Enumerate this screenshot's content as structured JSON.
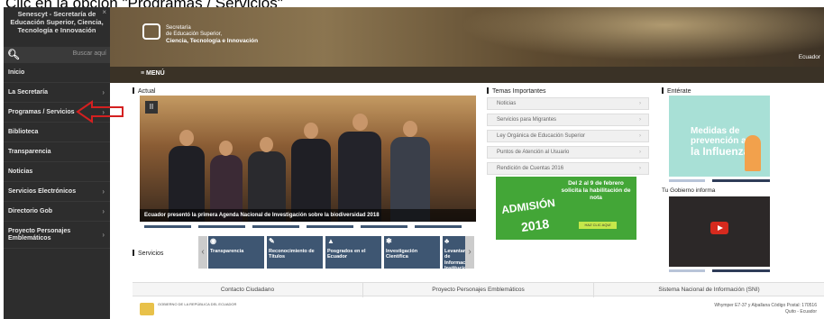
{
  "caption": "Clic en la opción \"Programas / Servicios\"",
  "sidebar": {
    "title": "Senescyt - Secretaría de Educación Superior, Ciencia, Tecnología e Innovación",
    "close_icon": "×",
    "search_placeholder": "Buscar aquí",
    "items": [
      {
        "label": "Inicio",
        "has_chevron": false
      },
      {
        "label": "La Secretaría",
        "has_chevron": true
      },
      {
        "label": "Programas / Servicios",
        "has_chevron": true
      },
      {
        "label": "Biblioteca",
        "has_chevron": false
      },
      {
        "label": "Transparencia",
        "has_chevron": false
      },
      {
        "label": "Noticias",
        "has_chevron": false
      },
      {
        "label": "Servicios Electrónicos",
        "has_chevron": true
      },
      {
        "label": "Directorio Gob",
        "has_chevron": true
      },
      {
        "label": "Proyecto Personajes Emblemáticos",
        "has_chevron": true
      }
    ]
  },
  "header": {
    "logo_line1": "Secretaría",
    "logo_line2": "de Educación Superior,",
    "logo_line3": "Ciencia, Tecnología e Innovación",
    "country": "Ecuador",
    "menu_label": "≡ MENÚ"
  },
  "main": {
    "actual_label": "Actual",
    "hero_caption": "Ecuador presentó la primera Agenda Nacional de Investigación sobre la biodiversidad 2018",
    "temas_label": "Temas Importantes",
    "temas": [
      "Noticias",
      "Servicios para Migrantes",
      "Ley Orgánica de Educación Superior",
      "Puntos de Atención al Usuario",
      "Rendición de Cuentas 2016"
    ],
    "admision": {
      "word": "ADMISIÓN",
      "year": "2018",
      "dates": "Del 2 al 9 de febrero solicita la habilitación de nota",
      "button": "HAZ CLIC AQUÍ"
    },
    "enterate_label": "Entérate",
    "influenza_line1": "Medidas de prevención ante",
    "influenza_line2": "la Influenza",
    "tu_gobierno_label": "Tu Gobierno informa",
    "servicios_label": "Servicios",
    "servicios": [
      {
        "label": "Transparencia",
        "icon": "eye-icon"
      },
      {
        "label": "Reconocimiento de Títulos",
        "icon": "edit-icon"
      },
      {
        "label": "Posgrados en el Ecuador",
        "icon": "graduation-cap-icon"
      },
      {
        "label": "Investigación Científica",
        "icon": "gear-icon"
      },
      {
        "label": "Levantamiento de Información Institucional",
        "icon": "sitemap-icon"
      }
    ]
  },
  "footer": {
    "links": [
      "Contacto Ciudadano",
      "Proyecto Personajes Emblemáticos",
      "Sistema Nacional de Información (SNI)"
    ],
    "logo_text": "GOBIERNO DE LA REPÚBLICA DEL ECUADOR",
    "address_line1": "Whymper E7-37 y Alpallana Código Postal: 170516",
    "address_line2": "Quito - Ecuador"
  },
  "colors": {
    "sidebar_bg": "#2d2d2d",
    "accent_blue": "#3e5672",
    "arrow_red": "#d42020",
    "admision_green": "#43a637"
  }
}
